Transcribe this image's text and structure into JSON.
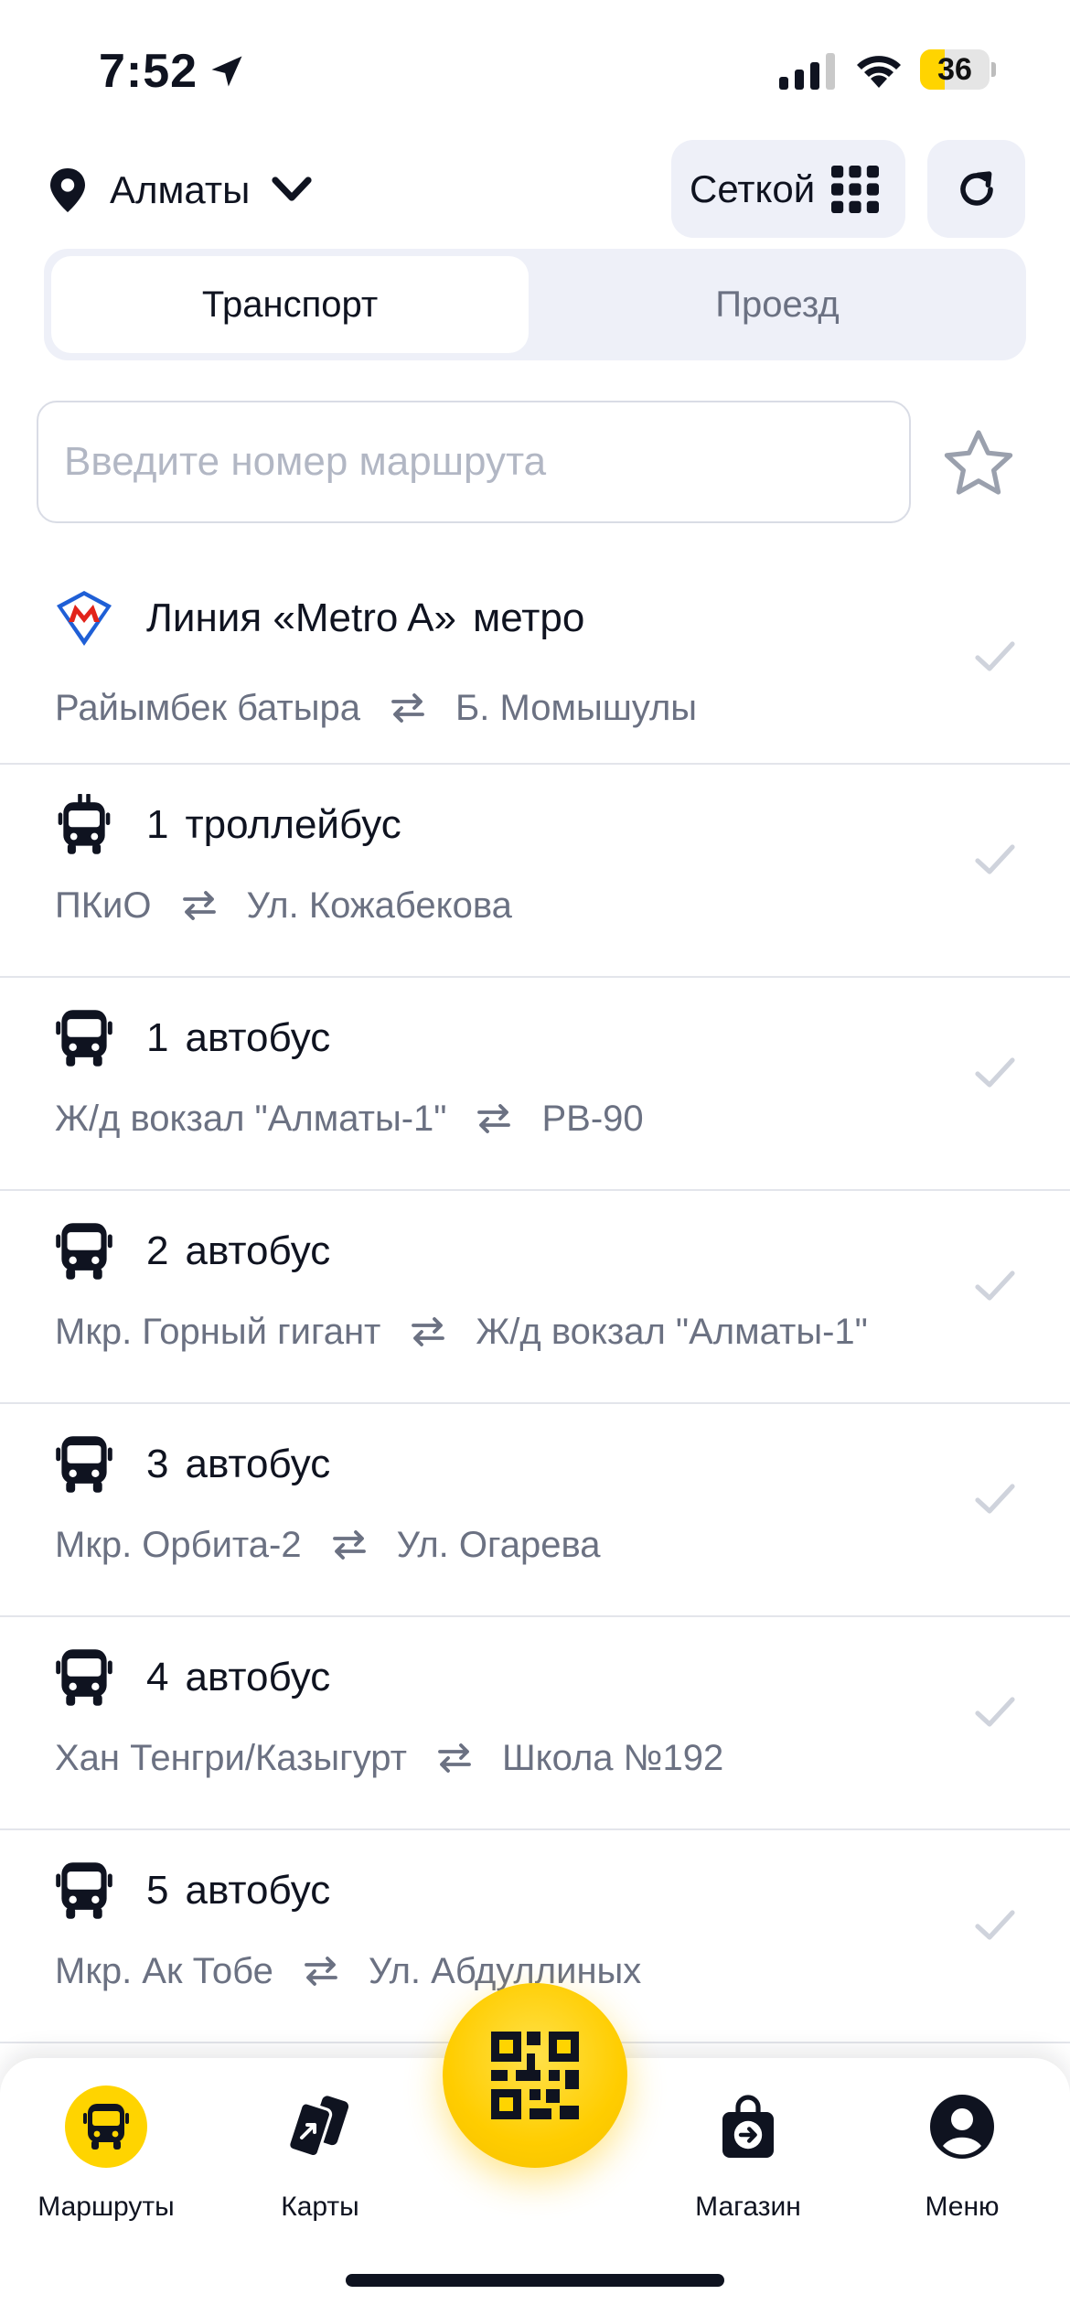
{
  "status_bar": {
    "time": "7:52",
    "battery_level": "36",
    "battery_fraction": 0.36
  },
  "header": {
    "city": "Алматы",
    "view_mode_label": "Сеткой"
  },
  "tabs": [
    {
      "label": "Транспорт",
      "active": true
    },
    {
      "label": "Проезд",
      "active": false
    }
  ],
  "search": {
    "placeholder": "Введите номер маршрута",
    "value": ""
  },
  "routes": [
    {
      "number": "Линия «Metro A»",
      "type": "метро",
      "icon": "metro-logo-icon",
      "from": "Райымбек батыра",
      "to": "Б. Момышулы"
    },
    {
      "number": "1",
      "type": "троллейбус",
      "icon": "trolleybus-icon",
      "from": "ПКиО",
      "to": "Ул. Кожабекова"
    },
    {
      "number": "1",
      "type": "автобус",
      "icon": "bus-icon",
      "from": "Ж/д вокзал \"Алматы-1\"",
      "to": "РВ-90"
    },
    {
      "number": "2",
      "type": "автобус",
      "icon": "bus-icon",
      "from": "Мкр. Горный гигант",
      "to": "Ж/д вокзал \"Алматы-1\""
    },
    {
      "number": "3",
      "type": "автобус",
      "icon": "bus-icon",
      "from": "Мкр. Орбита-2",
      "to": "Ул. Огарева"
    },
    {
      "number": "4",
      "type": "автобус",
      "icon": "bus-icon",
      "from": "Хан Тенгри/Казыгурт",
      "to": "Школа №192"
    },
    {
      "number": "5",
      "type": "автобус",
      "icon": "bus-icon",
      "from": "Мкр. Ак Тобе",
      "to": "Ул. Абдуллиных"
    }
  ],
  "bottom_nav": [
    {
      "label": "Маршруты",
      "icon": "bus-icon",
      "active": true
    },
    {
      "label": "Карты",
      "icon": "cards-icon",
      "active": false
    },
    {
      "label": "Магазин",
      "icon": "shop-bag-icon",
      "active": false
    },
    {
      "label": "Меню",
      "icon": "profile-icon",
      "active": false
    }
  ],
  "colors": {
    "accent": "#ffd400",
    "text_primary": "#0f1320",
    "text_secondary": "#6b7182",
    "segment_bg": "#eef0f8",
    "divider": "#e3e5eb"
  }
}
